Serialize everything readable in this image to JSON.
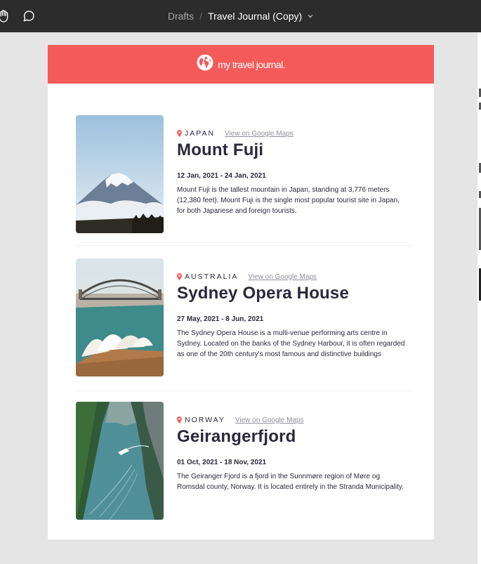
{
  "toolbar": {
    "breadcrumb_parent": "Drafts",
    "breadcrumb_separator": "/",
    "file_name": "Travel Journal (Copy)"
  },
  "header": {
    "brand_color": "#f55a5a",
    "logo_text": "my travel journal."
  },
  "entries": [
    {
      "country": "JAPAN",
      "maps_link": "View on Google Maps",
      "title": "Mount Fuji",
      "dates": "12 Jan, 2021 - 24 Jan, 2021",
      "description": "Mount Fuji is the tallest mountain in Japan, standing at 3,776 meters (12,380 feet). Mount Fuji is the single most popular tourist site in Japan, for both Japanese and foreign tourists."
    },
    {
      "country": "AUSTRALIA",
      "maps_link": "View on Google Maps",
      "title": "Sydney Opera House",
      "dates": "27 May, 2021 - 8 Jun, 2021",
      "description": "The Sydney Opera House is a multi-venue performing arts centre in Sydney. Located on the banks of the Sydney Harbour, it is often regarded as one of the 20th century's most famous and distinctive buildings"
    },
    {
      "country": "NORWAY",
      "maps_link": "View on Google Maps",
      "title": "Geirangerfjord",
      "dates": "01 Oct, 2021 - 18 Nov, 2021",
      "description": "The Geiranger Fjord is a fjord in the Sunnmøre region of Møre og Romsdal county, Norway. It is located entirely in the Stranda Municipality."
    }
  ],
  "colors": {
    "topbar": "#2c2c2c",
    "text_dark": "#2b283a",
    "text_muted": "#918e9b",
    "pin": "#f55a5a"
  }
}
